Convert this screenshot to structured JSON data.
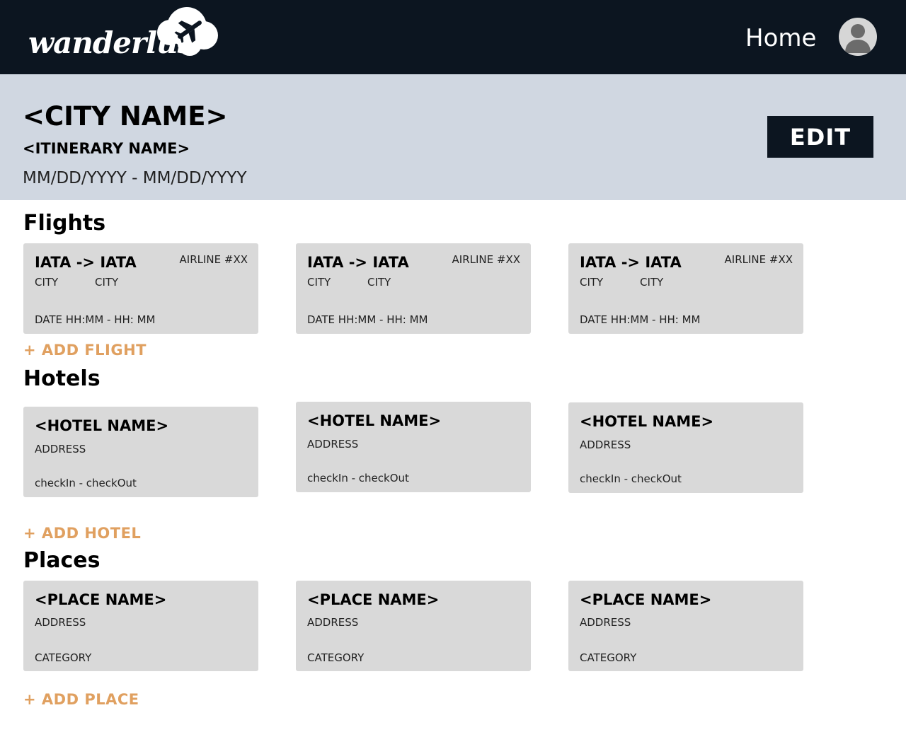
{
  "app": {
    "logo_text": "wanderlus",
    "nav_home": "Home"
  },
  "trip": {
    "city_name": "<CITY NAME>",
    "itinerary_name": "<ITINERARY NAME>",
    "dates": "MM/DD/YYYY - MM/DD/YYYY",
    "edit_label": "EDIT"
  },
  "flights": {
    "title": "Flights",
    "add_label": "+ ADD FLIGHT",
    "items": [
      {
        "route": "IATA -> IATA",
        "from_city": "CITY",
        "to_city": "CITY",
        "airline": "AIRLINE #XX",
        "time": "DATE HH:MM - HH: MM"
      },
      {
        "route": "IATA -> IATA",
        "from_city": "CITY",
        "to_city": "CITY",
        "airline": "AIRLINE #XX",
        "time": "DATE HH:MM - HH: MM"
      },
      {
        "route": "IATA -> IATA",
        "from_city": "CITY",
        "to_city": "CITY",
        "airline": "AIRLINE #XX",
        "time": "DATE HH:MM - HH: MM"
      }
    ]
  },
  "hotels": {
    "title": "Hotels",
    "add_label": "+ ADD HOTEL",
    "items": [
      {
        "name": "<HOTEL NAME>",
        "address": "ADDRESS",
        "stay": "checkIn - checkOut"
      },
      {
        "name": "<HOTEL NAME>",
        "address": "ADDRESS",
        "stay": "checkIn - checkOut"
      },
      {
        "name": "<HOTEL NAME>",
        "address": "ADDRESS",
        "stay": "checkIn - checkOut"
      }
    ]
  },
  "places": {
    "title": "Places",
    "add_label": "+ ADD PLACE",
    "items": [
      {
        "name": "<PLACE NAME>",
        "address": "ADDRESS",
        "category": "CATEGORY"
      },
      {
        "name": "<PLACE NAME>",
        "address": "ADDRESS",
        "category": "CATEGORY"
      },
      {
        "name": "<PLACE NAME>",
        "address": "ADDRESS",
        "category": "CATEGORY"
      }
    ]
  },
  "colors": {
    "topbar": "#0c1520",
    "header_band": "#d0d7e1",
    "card": "#d9d9d9",
    "accent": "#e0a060"
  },
  "icons": {
    "logo": "cloud-airplane-icon",
    "profile": "user-avatar-icon"
  }
}
